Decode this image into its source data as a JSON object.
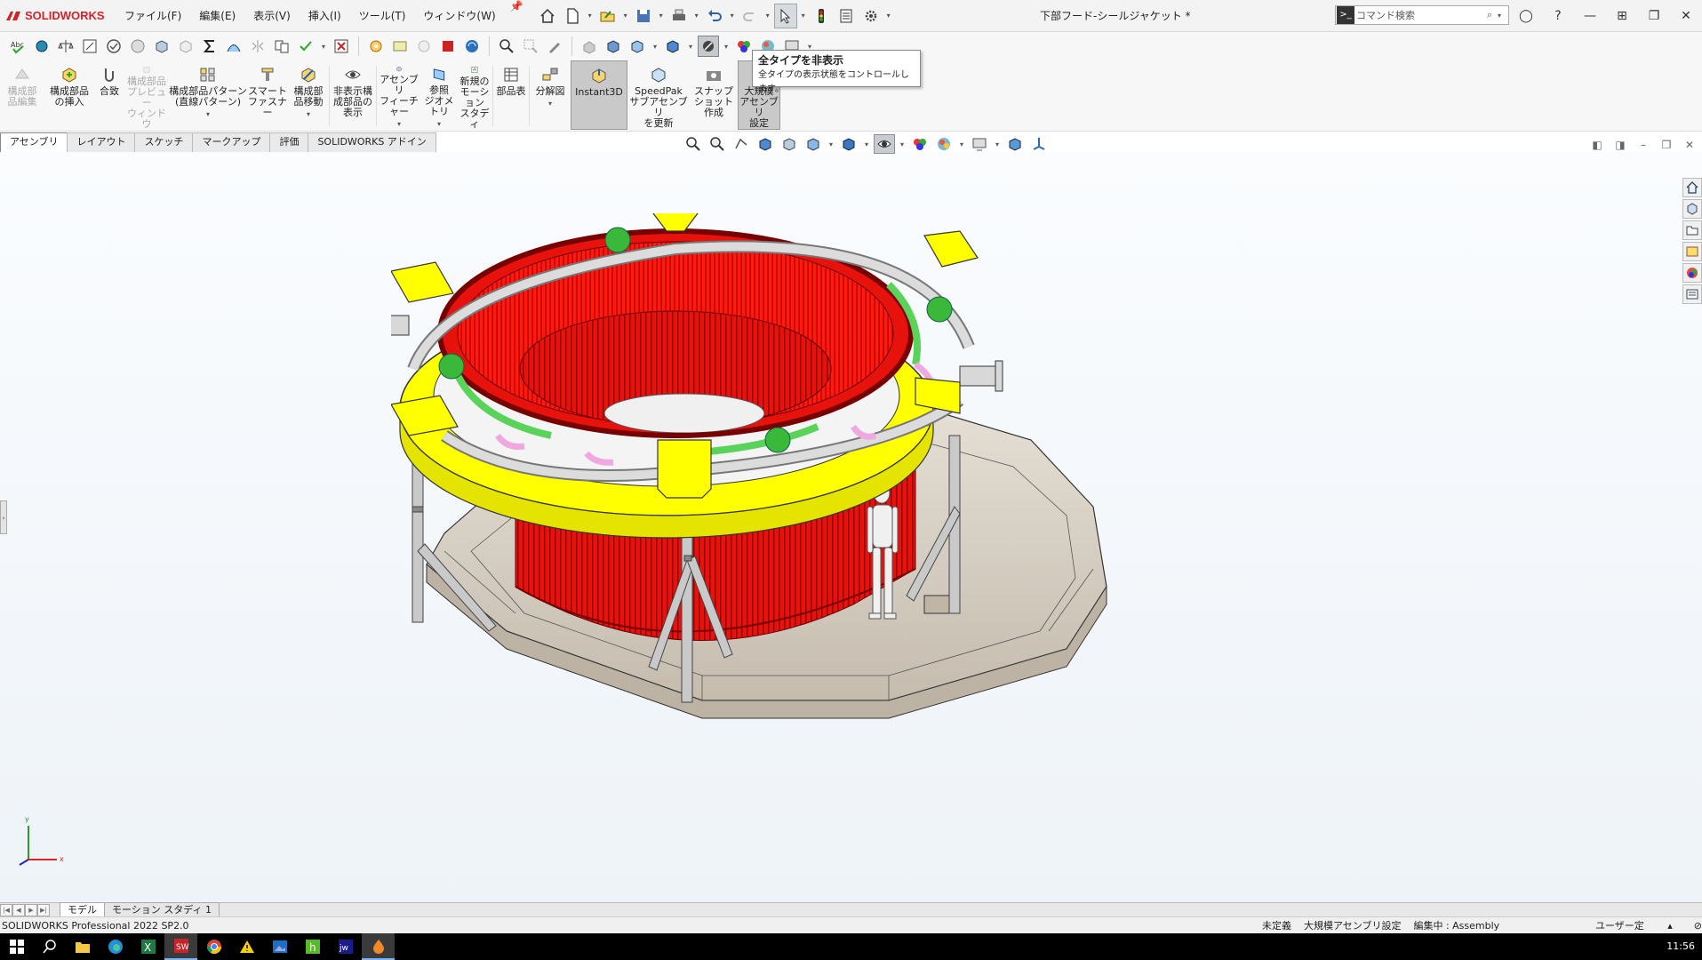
{
  "app": {
    "brand": "SOLIDWORKS",
    "doc_title": "下部フード-シールジャケット *"
  },
  "menus": [
    "ファイル(F)",
    "編集(E)",
    "表示(V)",
    "挿入(I)",
    "ツール(T)",
    "ウィンドウ(W)"
  ],
  "search": {
    "placeholder": "コマンド検索"
  },
  "tooltip": {
    "title": "全タイプを非表示",
    "desc": "全タイプの表示状態をコントロールします。"
  },
  "ribbon": [
    {
      "label": "構成部\n品編集",
      "icon": "edit-component-icon",
      "disabled": true
    },
    {
      "label": "構成部品\nの挿入",
      "icon": "insert-component-icon"
    },
    {
      "label": "合致",
      "icon": "mate-icon"
    },
    {
      "label": "構成部品\nプレビュー\nウィンドウ",
      "icon": "preview-window-icon",
      "disabled": true
    },
    {
      "label": "構成部品パターン\n(直線パターン)",
      "icon": "linear-pattern-icon",
      "caret": true
    },
    {
      "label": "スマート\nファスナー",
      "icon": "smart-fastener-icon"
    },
    {
      "label": "構成部\n品移動",
      "icon": "move-component-icon",
      "caret": true
    },
    {
      "label": "非表示構\n成部品の\n表示",
      "icon": "show-hidden-icon"
    },
    {
      "label": "アセンブリ\nフィーチャー",
      "icon": "assembly-feature-icon",
      "caret": true
    },
    {
      "label": "参照\nジオメトリ",
      "icon": "reference-geometry-icon",
      "caret": true
    },
    {
      "label": "新規の\nモーション\nスタディ",
      "icon": "motion-study-icon"
    },
    {
      "label": "部品表",
      "icon": "bom-icon"
    },
    {
      "label": "分解図",
      "icon": "exploded-view-icon",
      "caret": true
    },
    {
      "label": "Instant3D",
      "icon": "instant3d-icon",
      "active": true
    },
    {
      "label": "SpeedPak\nサブアセンブリ\nを更新",
      "icon": "speedpak-icon"
    },
    {
      "label": "スナップショット\n作成",
      "icon": "snapshot-icon"
    },
    {
      "label": "大規模\nアセンブリ\n設定",
      "icon": "large-assembly-icon",
      "active": true
    }
  ],
  "cmd_tabs": [
    "アセンブリ",
    "レイアウト",
    "スケッチ",
    "マークアップ",
    "評価",
    "SOLIDWORKS アドイン"
  ],
  "bottom_tabs": [
    "モデル",
    "モーション スタディ 1"
  ],
  "status": {
    "left": "SOLIDWORKS Professional 2022 SP2.0",
    "items": [
      "未定義",
      "大規模アセンブリ設定",
      "編集中 : Assembly"
    ],
    "units": "ユーザー定義"
  },
  "triad": {
    "x": "x",
    "y": "y"
  },
  "clock": "11:56",
  "colors": {
    "accent": "#d3232a",
    "model_red": "#e8120c",
    "model_yellow": "#ffff00",
    "model_base": "#d6cfc2"
  }
}
